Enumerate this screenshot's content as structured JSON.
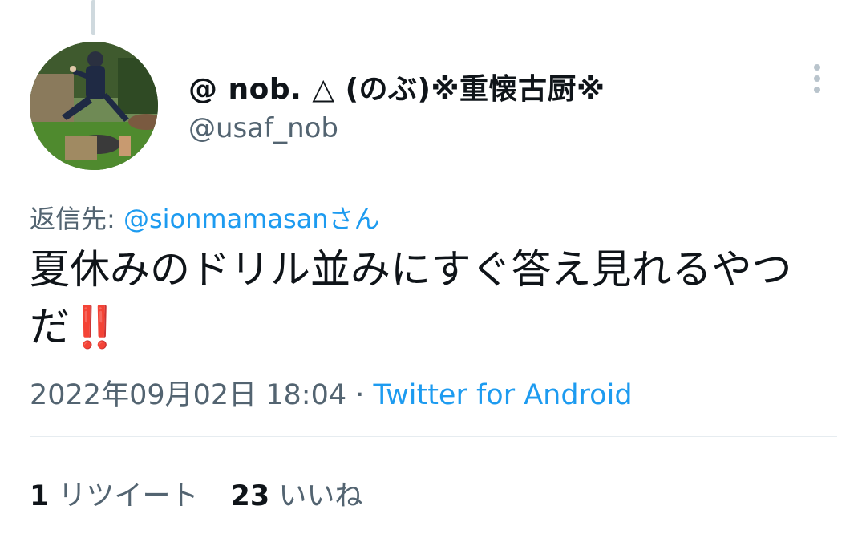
{
  "tweet": {
    "author": {
      "display_name": "@ nob. △ (のぶ)※重懐古厨※",
      "handle": "@usaf_nob",
      "avatar_icon": "profile-photo"
    },
    "reply": {
      "prefix": "返信先: ",
      "to": "@sionmamasan",
      "suffix": "さん"
    },
    "text": "夏休みのドリル並みにすぐ答え見れるやつだ",
    "emoji": "‼️",
    "timestamp": "2022年09月02日 18:04",
    "separator": " · ",
    "source": "Twitter for Android",
    "stats": {
      "retweets_count": "1",
      "retweets_label": "リツイート",
      "likes_count": "23",
      "likes_label": "いいね"
    }
  },
  "colors": {
    "link": "#1d9bf0",
    "secondary_text": "#536471",
    "primary_text": "#0f1419",
    "emoji_red": "#d01f3c",
    "divider": "#e6ecf0"
  }
}
